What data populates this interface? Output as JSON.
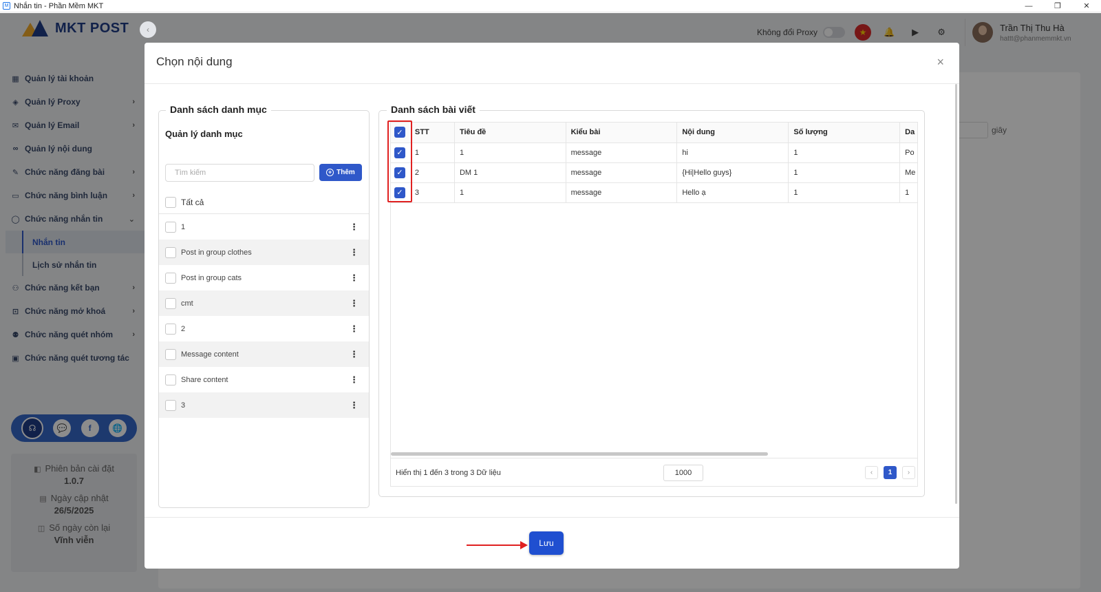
{
  "window": {
    "title": "Nhắn tin - Phần Mềm MKT",
    "controls": [
      "—",
      "❐",
      "✕"
    ]
  },
  "brand": {
    "logo_text": "MKT POST"
  },
  "sidebar": {
    "collapse": "‹",
    "items": [
      {
        "label": "Quản lý tài khoản",
        "icon": "grid-icon",
        "glyph": "▦",
        "chevron": ""
      },
      {
        "label": "Quản lý Proxy",
        "icon": "layers-icon",
        "glyph": "◈",
        "chevron": "›"
      },
      {
        "label": "Quản lý Email",
        "icon": "mail-icon",
        "glyph": "✉",
        "chevron": "›"
      },
      {
        "label": "Quản lý nội dung",
        "icon": "link-icon",
        "glyph": "∞",
        "chevron": ""
      },
      {
        "label": "Chức năng đăng bài",
        "icon": "post-icon",
        "glyph": "✎",
        "chevron": "›"
      },
      {
        "label": "Chức năng bình luận",
        "icon": "comment-icon",
        "glyph": "▭",
        "chevron": "›"
      },
      {
        "label": "Chức năng nhắn tin",
        "icon": "chat-icon",
        "glyph": "◯",
        "chevron": "⌄"
      }
    ],
    "subitems": [
      {
        "label": "Nhắn tin",
        "active": true
      },
      {
        "label": "Lịch sử nhắn tin",
        "active": false
      }
    ],
    "items2": [
      {
        "label": "Chức năng kết bạn",
        "icon": "add-friend-icon",
        "glyph": "⚇",
        "chevron": "›"
      },
      {
        "label": "Chức năng mở khoá",
        "icon": "lock-icon",
        "glyph": "⊡",
        "chevron": "›"
      },
      {
        "label": "Chức năng quét nhóm",
        "icon": "group-icon",
        "glyph": "⚉",
        "chevron": "›"
      },
      {
        "label": "Chức năng quét tương tác",
        "icon": "scan-icon",
        "glyph": "▣",
        "chevron": ""
      }
    ],
    "social": [
      "☊",
      "💬",
      "f",
      "🌐"
    ],
    "version": {
      "version_label": "Phiên bản cài đặt",
      "version_value": "1.0.7",
      "update_label": "Ngày cập nhật",
      "update_value": "26/5/2025",
      "days_label": "Số ngày còn lại",
      "days_value": "Vĩnh viễn"
    }
  },
  "header": {
    "proxy_label": "Không đổi Proxy",
    "proxy_on": false,
    "user_name": "Trần Thị Thu Hà",
    "user_email": "hattt@phanmemmkt.vn",
    "icons": [
      "★",
      "🔔",
      "▶",
      "⚙"
    ]
  },
  "background": {
    "seconds_label": "giây"
  },
  "modal": {
    "title": "Chọn nội dung",
    "close": "×",
    "left": {
      "legend": "Danh sách danh mục",
      "manage_title": "Quản lý danh mục",
      "search_placeholder": "Tìm kiếm",
      "add_label": "Thêm",
      "add_glyph": "+",
      "select_all": "Tất cả",
      "categories": [
        "1",
        "Post in group clothes",
        "Post in group cats",
        "cmt",
        "2",
        "Message content",
        "Share content",
        "3"
      ],
      "menu_glyph": "⋮"
    },
    "right": {
      "legend": "Danh sách bài viết",
      "columns": [
        "STT",
        "Tiêu đề",
        "Kiểu bài",
        "Nội dung",
        "Số lượng",
        "Da"
      ],
      "rows": [
        {
          "stt": "1",
          "title": "1",
          "type": "message",
          "content": "hi",
          "qty": "1",
          "extra": "Po",
          "checked": true
        },
        {
          "stt": "2",
          "title": "DM 1",
          "type": "message",
          "content": "{Hi|Hello guys}",
          "qty": "1",
          "extra": "Me",
          "checked": true
        },
        {
          "stt": "3",
          "title": "1",
          "type": "message",
          "content": "Hello ạ",
          "qty": "1",
          "extra": "1",
          "checked": true
        }
      ],
      "check_glyph": "✓",
      "footer_info": "Hiển thị 1 đến 3 trong 3 Dữ liệu",
      "page_size": "1000",
      "pager": {
        "prev": "‹",
        "current": "1",
        "next": "›"
      }
    },
    "save_label": "Lưu"
  },
  "colors": {
    "primary": "#2f58c9",
    "highlight": "#e02020",
    "sidebar_bg": "#f1f2f4"
  }
}
